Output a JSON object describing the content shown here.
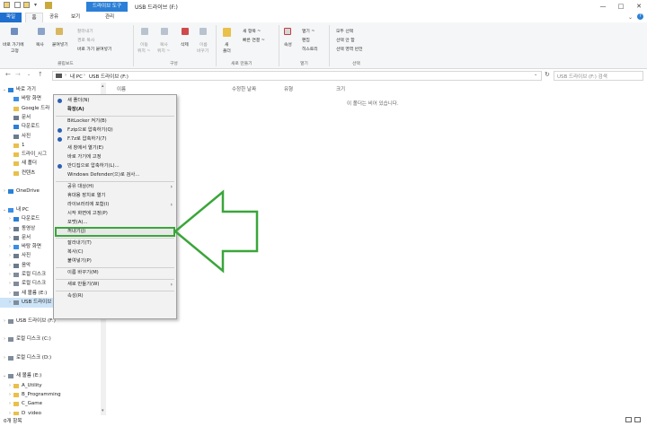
{
  "window": {
    "context_tab": "드라이브 도구",
    "title": "USB 드라이브 (F:)",
    "controls": [
      "—",
      "□",
      "✕"
    ]
  },
  "ribbon": {
    "tabs": [
      "파일",
      "홈",
      "공유",
      "보기",
      "관리"
    ],
    "clipboard": {
      "pin_label_1": "바로 가기에",
      "pin_label_2": "고정",
      "copy": "복사",
      "paste": "붙여넣기",
      "cut": "잘라내기",
      "copy_path": "경로 복사",
      "paste_shortcut": "바로 가기 붙여넣기",
      "group": "클립보드"
    },
    "organize": {
      "move_1": "이동",
      "move_2": "위치 ~",
      "copy_1": "복사",
      "copy_2": "위치 ~",
      "delete": "삭제",
      "rename_1": "이름",
      "rename_2": "바꾸기",
      "group": "구성"
    },
    "new": {
      "folder_1": "새",
      "folder_2": "폴더",
      "new_item": "새 항목 ~",
      "easy_access": "빠른 연결 ~",
      "group": "새로 만들기"
    },
    "open": {
      "properties": "속성",
      "open": "열기 ~",
      "edit": "편집",
      "history": "히스토리",
      "group": "열기"
    },
    "select": {
      "select_all": "모두 선택",
      "select_none": "선택 안 함",
      "invert": "선택 영역 반전",
      "group": "선택"
    }
  },
  "address": {
    "path": [
      "내 PC",
      "USB 드라이브 (F:)"
    ],
    "search_placeholder": "USB 드라이브 (F:) 검색"
  },
  "columns": [
    "이름",
    "수정한 날짜",
    "유형",
    "크기"
  ],
  "empty_message": "이 폴더는 비어 있습니다.",
  "nav": [
    {
      "label": "바로 가기",
      "indent": 0,
      "chev": "v",
      "icon": "star-icon",
      "color": "#2b7fd6"
    },
    {
      "label": "바탕 화면",
      "indent": 1,
      "chev": "",
      "icon": "desktop-icon",
      "color": "#3a8ee6"
    },
    {
      "label": "Google 드라",
      "indent": 1,
      "chev": "",
      "icon": "folder-icon",
      "color": "#e8c04a"
    },
    {
      "label": "문서",
      "indent": 1,
      "chev": "",
      "icon": "document-icon",
      "color": "#6b7b8c"
    },
    {
      "label": "다운로드",
      "indent": 1,
      "chev": "",
      "icon": "download-icon",
      "color": "#2b7fd6"
    },
    {
      "label": "사진",
      "indent": 1,
      "chev": "",
      "icon": "picture-icon",
      "color": "#6b7b8c"
    },
    {
      "label": "1",
      "indent": 1,
      "chev": "",
      "icon": "folder-icon",
      "color": "#e8c04a"
    },
    {
      "label": "드라이_시그",
      "indent": 1,
      "chev": "",
      "icon": "folder-icon",
      "color": "#e8c04a"
    },
    {
      "label": "새 폴더",
      "indent": 1,
      "chev": "",
      "icon": "folder-icon",
      "color": "#e8c04a"
    },
    {
      "label": "컨텐츠",
      "indent": 1,
      "chev": "",
      "icon": "folder-icon",
      "color": "#e8c04a"
    },
    {
      "label": "",
      "indent": 0,
      "chev": "",
      "icon": "",
      "color": ""
    },
    {
      "label": "OneDrive",
      "indent": 0,
      "chev": ">",
      "icon": "cloud-icon",
      "color": "#2b7fd6"
    },
    {
      "label": "",
      "indent": 0,
      "chev": "",
      "icon": "",
      "color": ""
    },
    {
      "label": "내 PC",
      "indent": 0,
      "chev": "v",
      "icon": "pc-icon",
      "color": "#3a8ee6"
    },
    {
      "label": "다운로드",
      "indent": 1,
      "chev": ">",
      "icon": "download-icon",
      "color": "#2b7fd6"
    },
    {
      "label": "동영상",
      "indent": 1,
      "chev": ">",
      "icon": "video-icon",
      "color": "#6b7b8c"
    },
    {
      "label": "문서",
      "indent": 1,
      "chev": ">",
      "icon": "document-icon",
      "color": "#6b7b8c"
    },
    {
      "label": "바탕 화면",
      "indent": 1,
      "chev": ">",
      "icon": "desktop-icon",
      "color": "#3a8ee6"
    },
    {
      "label": "사진",
      "indent": 1,
      "chev": ">",
      "icon": "picture-icon",
      "color": "#6b7b8c"
    },
    {
      "label": "음악",
      "indent": 1,
      "chev": ">",
      "icon": "music-icon",
      "color": "#6b7b8c"
    },
    {
      "label": "로컬 디스크",
      "indent": 1,
      "chev": ">",
      "icon": "drive-icon",
      "color": "#7f8c99"
    },
    {
      "label": "로컬 디스크",
      "indent": 1,
      "chev": ">",
      "icon": "drive-icon",
      "color": "#7f8c99"
    },
    {
      "label": "새 볼륨 (E:)",
      "indent": 1,
      "chev": ">",
      "icon": "drive-icon",
      "color": "#7f8c99"
    },
    {
      "label": "USB 드라이브",
      "indent": 1,
      "chev": ">",
      "icon": "usb-icon",
      "color": "#7f8c99",
      "selected": true
    },
    {
      "label": "",
      "indent": 0,
      "chev": "",
      "icon": "",
      "color": ""
    },
    {
      "label": "USB 드라이브 (F:)",
      "indent": 0,
      "chev": ">",
      "icon": "usb-icon",
      "color": "#7f8c99"
    },
    {
      "label": "",
      "indent": 0,
      "chev": "",
      "icon": "",
      "color": ""
    },
    {
      "label": "로컬 디스크 (C:)",
      "indent": 0,
      "chev": ">",
      "icon": "drive-icon",
      "color": "#7f8c99"
    },
    {
      "label": "",
      "indent": 0,
      "chev": "",
      "icon": "",
      "color": ""
    },
    {
      "label": "로컬 디스크 (D:)",
      "indent": 0,
      "chev": ">",
      "icon": "drive-icon",
      "color": "#7f8c99"
    },
    {
      "label": "",
      "indent": 0,
      "chev": "",
      "icon": "",
      "color": ""
    },
    {
      "label": "새 볼륨 (E:)",
      "indent": 0,
      "chev": "v",
      "icon": "drive-icon",
      "color": "#7f8c99"
    },
    {
      "label": "A_Utility",
      "indent": 1,
      "chev": ">",
      "icon": "folder-icon",
      "color": "#e8c04a"
    },
    {
      "label": "B_Programming",
      "indent": 1,
      "chev": ">",
      "icon": "folder-icon",
      "color": "#e8c04a"
    },
    {
      "label": "C_Game",
      "indent": 1,
      "chev": ">",
      "icon": "folder-icon",
      "color": "#e8c04a"
    },
    {
      "label": "D_video",
      "indent": 1,
      "chev": ">",
      "icon": "folder-icon",
      "color": "#e8c04a"
    }
  ],
  "status": "0개 항목",
  "menu": [
    {
      "label": "새 폴더(N)",
      "icon": true,
      "sep_after": false
    },
    {
      "label": "확장(A)",
      "bold": true,
      "sep_after": true
    },
    {
      "label": "BitLocker 켜기(B)",
      "sep_after": false
    },
    {
      "label": "F.zip으로 압축하기(Q)",
      "icon": true
    },
    {
      "label": "F.7z로 압축하기(7)",
      "icon": true
    },
    {
      "label": "새 창에서 열기(E)"
    },
    {
      "label": "바로 가기에 고정"
    },
    {
      "label": "반디집으로 압축하기(L)...",
      "icon": true
    },
    {
      "label": "Windows Defender(으)로 검사...",
      "sep_after": true
    },
    {
      "label": "공유 대상(H)",
      "arrow": true
    },
    {
      "label": "휴대용 장치로 열기"
    },
    {
      "label": "라이브러리에 포함(I)",
      "arrow": true
    },
    {
      "label": "시작 화면에 고정(P)"
    },
    {
      "label": "포맷(A)...",
      "highlight": true
    },
    {
      "label": "꺼내기(J)",
      "sep_after": true
    },
    {
      "label": "잘라내기(T)"
    },
    {
      "label": "복사(C)"
    },
    {
      "label": "붙여넣기(P)",
      "sep_after": true
    },
    {
      "label": "이름 바꾸기(M)",
      "sep_after": true
    },
    {
      "label": "새로 만들기(W)",
      "arrow": true,
      "sep_after": true
    },
    {
      "label": "속성(R)"
    }
  ],
  "colors": {
    "accent": "#1e6fcf",
    "highlight_box": "#3aa63a",
    "arrow": "#3aa63a",
    "selection": "#cce4f7"
  }
}
